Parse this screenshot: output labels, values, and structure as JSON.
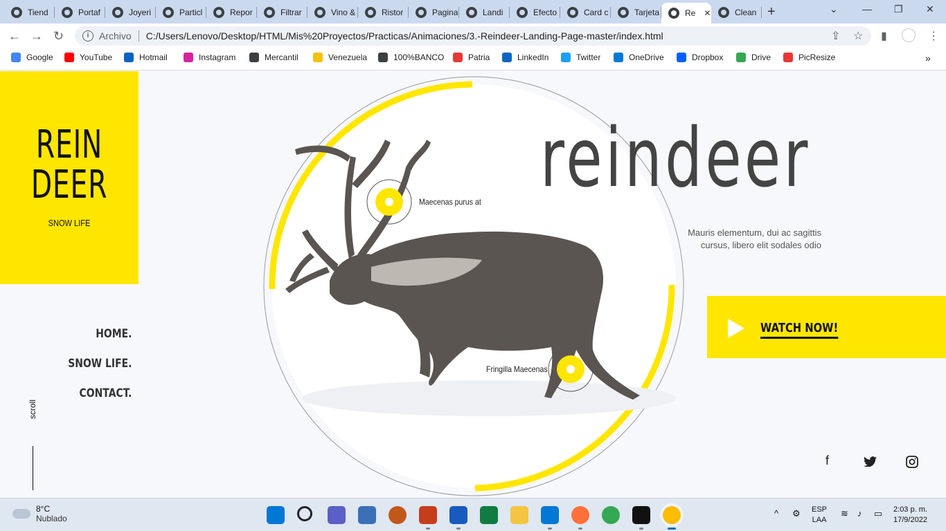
{
  "browser": {
    "tabs": [
      {
        "label": "Tiend",
        "active": false
      },
      {
        "label": "Portaf",
        "active": false
      },
      {
        "label": "Joyeri",
        "active": false
      },
      {
        "label": "Particl",
        "active": false
      },
      {
        "label": "Repor",
        "active": false
      },
      {
        "label": "Filtrar",
        "active": false
      },
      {
        "label": "Vino &",
        "active": false
      },
      {
        "label": "Ristor",
        "active": false
      },
      {
        "label": "Pagina",
        "active": false
      },
      {
        "label": "Landi",
        "active": false
      },
      {
        "label": "Efecto",
        "active": false
      },
      {
        "label": "Card c",
        "active": false
      },
      {
        "label": "Tarjeta",
        "active": false
      },
      {
        "label": "Re",
        "active": true
      },
      {
        "label": "Clean",
        "active": false
      }
    ],
    "url_scheme": "Archivo",
    "url": "C:/Users/Lenovo/Desktop/HTML/Mis%20Proyectos/Practicas/Animaciones/3.-Reindeer-Landing-Page-master/index.html",
    "bookmarks": [
      {
        "label": "Google",
        "color": "#4285f4"
      },
      {
        "label": "YouTube",
        "color": "#ff0000"
      },
      {
        "label": "Hotmail",
        "color": "#0a64c2"
      },
      {
        "label": "Instagram",
        "color": "#d6249f"
      },
      {
        "label": "Mercantil",
        "color": "#3c4043"
      },
      {
        "label": "Venezuela",
        "color": "#f4c20d"
      },
      {
        "label": "100%BANCO",
        "color": "#3c4043"
      },
      {
        "label": "Patria",
        "color": "#e53935"
      },
      {
        "label": "LinkedIn",
        "color": "#0a66c2"
      },
      {
        "label": "Twitter",
        "color": "#1da1f2"
      },
      {
        "label": "OneDrive",
        "color": "#0078d4"
      },
      {
        "label": "Dropbox",
        "color": "#0061fe"
      },
      {
        "label": "Drive",
        "color": "#34a853"
      },
      {
        "label": "PicResize",
        "color": "#e53935"
      }
    ]
  },
  "site": {
    "logo_line1": "REIN",
    "logo_line2": "DEER",
    "logo_sub": "SNOW LIFE",
    "nav": [
      "HOME.",
      "SNOW LIFE.",
      "CONTACT."
    ],
    "scroll_label": "scroll",
    "title": "reindeer",
    "description_line1": "Mauris elementum, dui ac sagittis",
    "description_line2": "cursus, libero elit sodales odio",
    "watch_label": "WATCH NOW!",
    "hotspot1": "Maecenas purus at",
    "hotspot2": "Fringilla Maecenas",
    "accent_color": "#ffe600"
  },
  "taskbar": {
    "temperature": "8°C",
    "weather": "Nublado",
    "lang1": "ESP",
    "lang2": "LAA",
    "time": "2:03 p. m.",
    "date": "17/9/2022"
  }
}
